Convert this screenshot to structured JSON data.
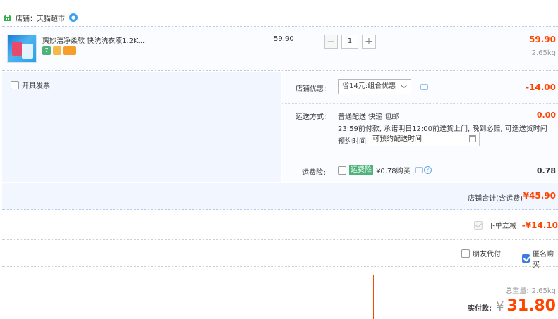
{
  "shop": {
    "name": "店铺：天猫超市"
  },
  "item": {
    "title": "爽妙洁净柔软 快洗洗衣液1.2K...",
    "unit_price": "59.90",
    "quantity": "1",
    "total": "59.90",
    "weight": "2.65kg",
    "badges": [
      "7",
      "",
      ""
    ]
  },
  "options": {
    "invoice_label": "开具发票",
    "discount": {
      "label": "店铺优惠:",
      "selected": "省14元:组合优惠",
      "value": "-14.00"
    },
    "shipping": {
      "label": "运送方式:",
      "line1": "普通配送 快递 包邮",
      "line2": "23:59前付款, 承诺明日12:00前送货上门, 晚到必赔, 可选送货时间",
      "time_label": "预约时间",
      "time_placeholder": "可预约配送时间",
      "value": "0.00"
    },
    "insurance": {
      "label": "运费险:",
      "tag": "运费险",
      "price": "¥0.78购买",
      "value": "0.78"
    }
  },
  "shop_total": {
    "label": "店铺合计(含运费)",
    "value": "¥45.90"
  },
  "instant_discount": {
    "label": "下单立减",
    "value": "-¥14.10"
  },
  "extras": {
    "friend_pay": "朋友代付",
    "anonymous": "匿名购买"
  },
  "summary": {
    "weight_label": "总重量:",
    "weight_value": "2.65kg",
    "pay_label": "实付款:",
    "currency": "¥",
    "pay_value": "31.80"
  },
  "colors": {
    "accent": "#ff4400",
    "panel": "#f2f7ff",
    "green_tag": "#4db37a"
  }
}
